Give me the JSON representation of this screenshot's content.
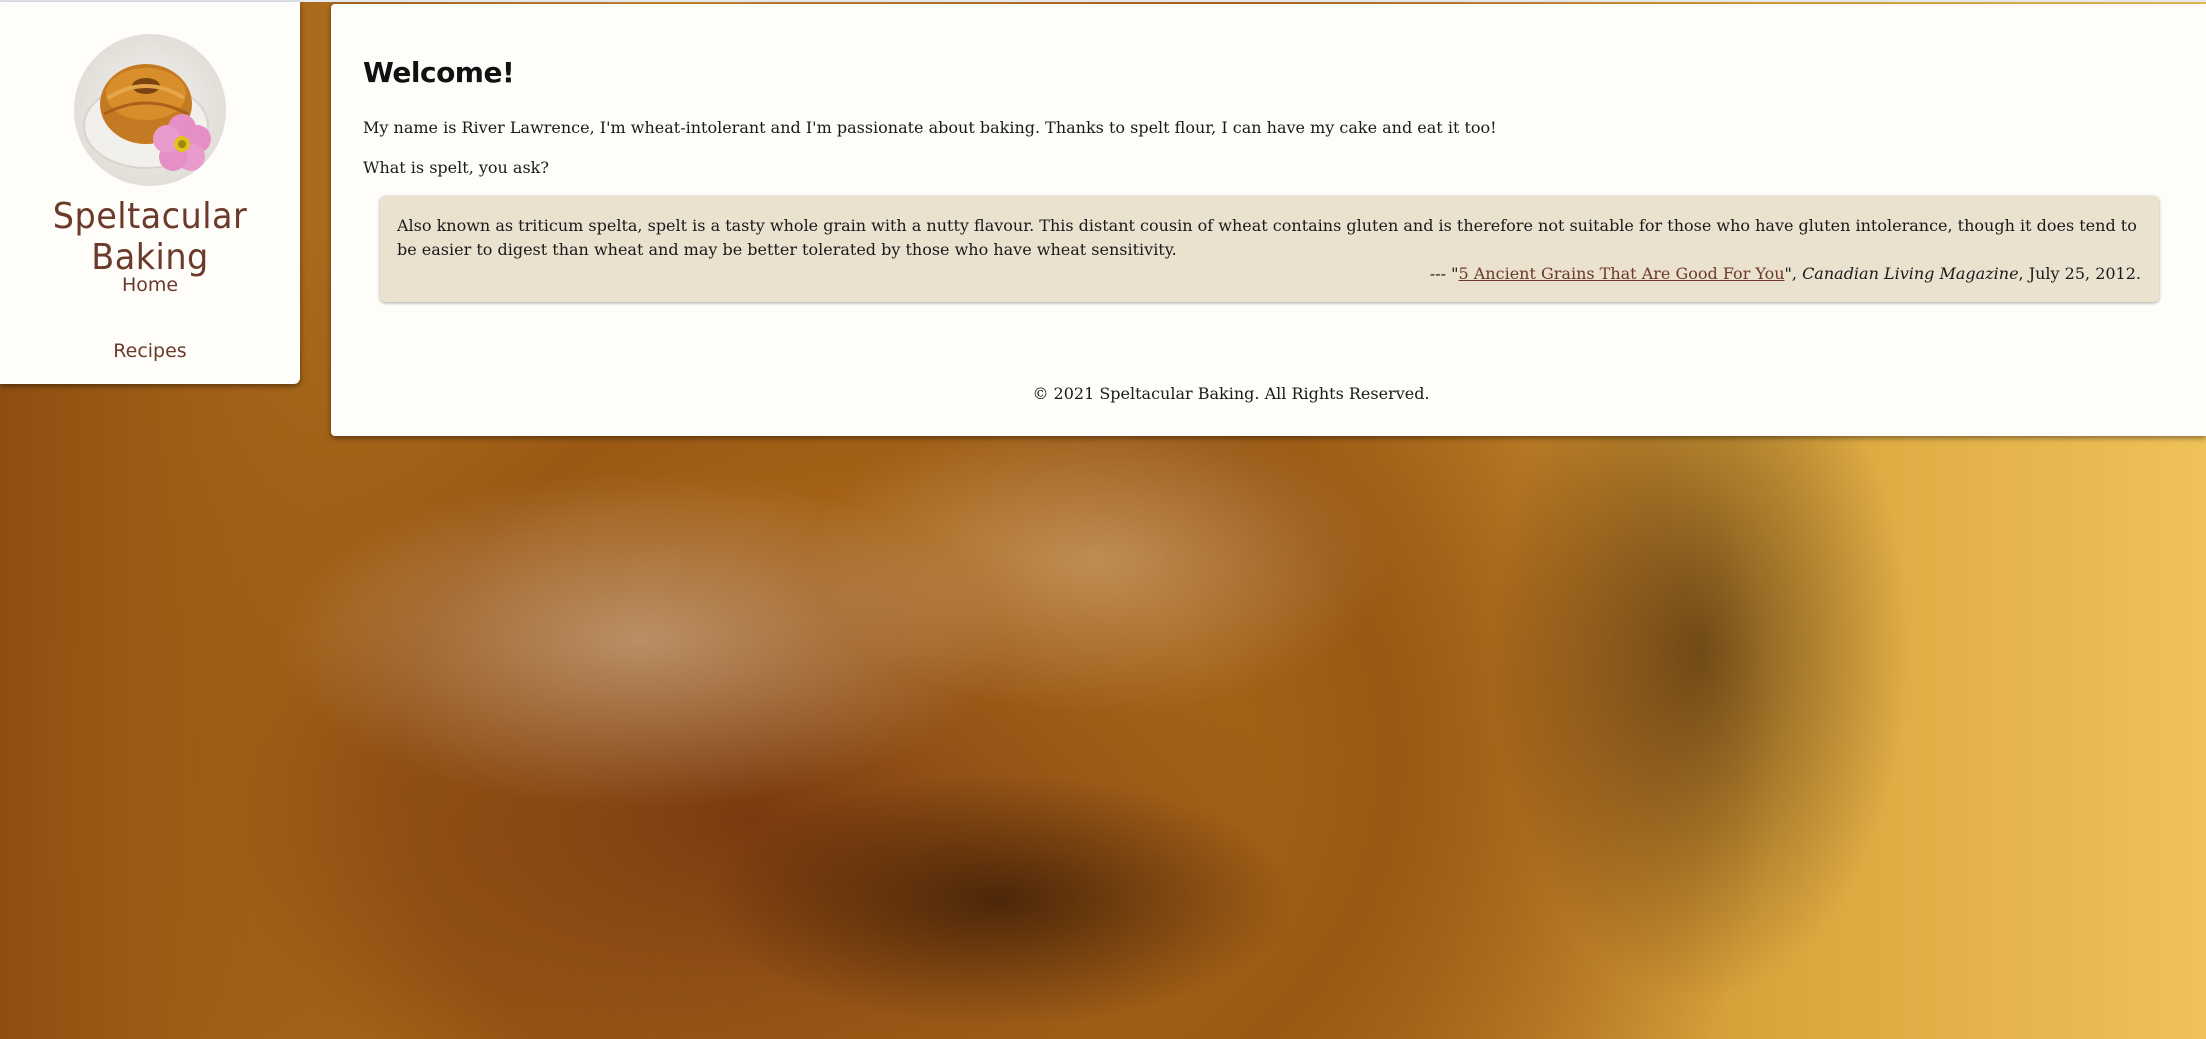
{
  "site": {
    "title": "Speltacular Baking",
    "logo_icon": "bundt-cake-with-flower-icon"
  },
  "nav": {
    "items": [
      {
        "label": "Home"
      },
      {
        "label": "Recipes"
      }
    ]
  },
  "main": {
    "heading": "Welcome!",
    "intro": "My name is River Lawrence, I'm wheat-intolerant and I'm passionate about baking. Thanks to spelt flour, I can have my cake and eat it too!",
    "question": "What is spelt, you ask?",
    "quote": {
      "text": "Also known as triticum spelta, spelt is a tasty whole grain with a nutty flavour. This distant cousin of wheat contains gluten and is therefore not suitable for those who have gluten intolerance, though it does tend to be easier to digest than wheat and may be better tolerated by those who have wheat sensitivity.",
      "cite_prefix": "--- \"",
      "link_text": "5 Ancient Grains That Are Good For You",
      "cite_mid": "\", ",
      "source": "Canadian Living Magazine",
      "date": ", July 25, 2012."
    }
  },
  "footer": {
    "text": "© 2021 Speltacular Baking. All Rights Reserved."
  },
  "colors": {
    "accent": "#6b3a2a",
    "panel": "#fffdf9",
    "quote_bg": "#ebe1cf"
  }
}
